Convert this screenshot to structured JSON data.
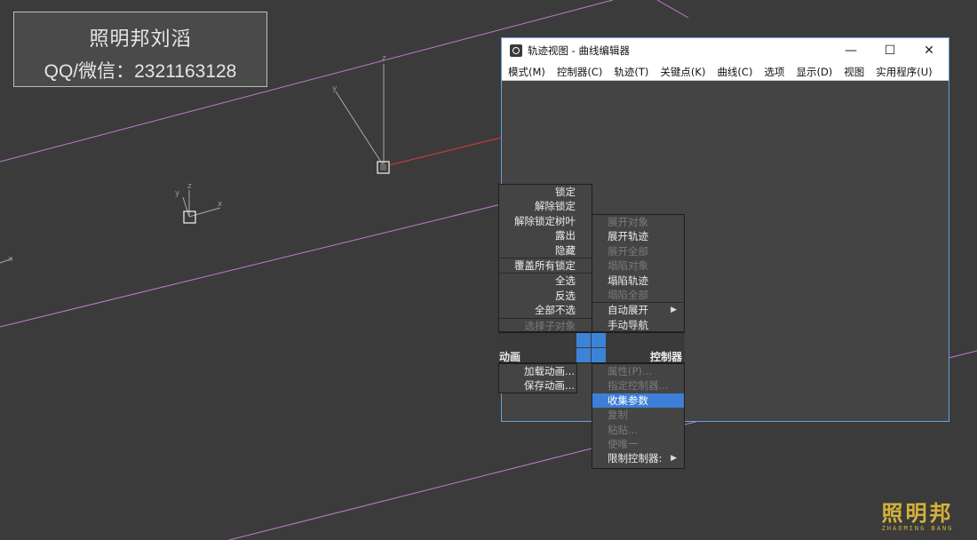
{
  "watermark": {
    "line1": "照明邦刘滔",
    "line2": "QQ/微信：2321163128"
  },
  "window": {
    "title": "轨迹视图 - 曲线编辑器",
    "controls": {
      "minimize": "—",
      "maximize": "☐",
      "close": "✕"
    },
    "menu": [
      "模式(M)",
      "控制器(C)",
      "轨迹(T)",
      "关键点(K)",
      "曲线(C)",
      "选项",
      "显示(D)",
      "视图",
      "实用程序(U)"
    ]
  },
  "quad_menu": {
    "left_top": [
      {
        "label": "锁定",
        "enabled": true
      },
      {
        "label": "解除锁定",
        "enabled": true
      },
      {
        "label": "解除锁定树叶",
        "enabled": true
      },
      {
        "label": "露出",
        "enabled": true
      },
      {
        "label": "隐藏",
        "enabled": true
      },
      {
        "label": "覆盖所有锁定",
        "enabled": true
      },
      {
        "label": "全选",
        "enabled": true
      },
      {
        "label": "反选",
        "enabled": true
      },
      {
        "label": "全部不选",
        "enabled": true
      },
      {
        "label": "选择子对象",
        "enabled": false
      }
    ],
    "right_top": [
      {
        "label": "展开对象",
        "enabled": false
      },
      {
        "label": "展开轨迹",
        "enabled": true
      },
      {
        "label": "展开全部",
        "enabled": false
      },
      {
        "label": "塌陷对象",
        "enabled": false
      },
      {
        "label": "塌陷轨迹",
        "enabled": true
      },
      {
        "label": "塌陷全部",
        "enabled": false
      },
      {
        "label": "自动展开",
        "enabled": true,
        "submenu": true
      },
      {
        "label": "手动导航",
        "enabled": true
      }
    ],
    "header_left": "动画",
    "header_right": "控制器",
    "left_bottom": [
      {
        "label": "加载动画...",
        "enabled": true
      },
      {
        "label": "保存动画...",
        "enabled": true
      }
    ],
    "right_bottom": [
      {
        "label": "属性(P)...",
        "enabled": false
      },
      {
        "label": "指定控制器...",
        "enabled": false
      },
      {
        "label": "收集参数",
        "enabled": true,
        "highlighted": true
      },
      {
        "label": "复制",
        "enabled": false
      },
      {
        "label": "粘贴...",
        "enabled": false
      },
      {
        "label": "使唯一",
        "enabled": false
      },
      {
        "label": "限制控制器:",
        "enabled": true,
        "submenu": true
      }
    ]
  },
  "viewport_axis_labels": [
    "y",
    "z",
    "x",
    "y",
    "z",
    "x",
    "x"
  ],
  "logo": {
    "main": "照明邦",
    "sub": "ZHAOMING BANG"
  },
  "colors": {
    "viewport_bg": "#3b3b3b",
    "highlight": "#3d7fd6",
    "grid_line": "#c27ad0",
    "x_axis": "#c23a3a",
    "logo": "#d4b23a"
  }
}
